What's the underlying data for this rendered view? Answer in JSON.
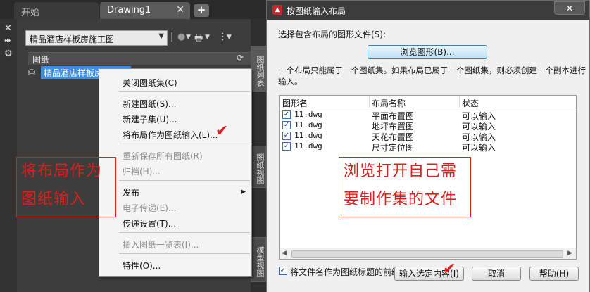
{
  "tabs": {
    "start": "开始",
    "drawing": "Drawing1",
    "close": "✕",
    "new_tab": "+"
  },
  "left_strip": {
    "close": "✕",
    "pin": "⇹",
    "props": "⚙"
  },
  "palette": {
    "sheet_set": "精品酒店样板房施工图",
    "tree_header": "图纸",
    "tree_item": "精品酒店样板房施工图",
    "vertical_tabs": [
      "图纸列表",
      "图纸视图",
      "模型视图"
    ]
  },
  "context_menu": {
    "items": [
      {
        "label": "关闭图纸集(C)",
        "disabled": false
      },
      {
        "label": "新建图纸(S)...",
        "disabled": false
      },
      {
        "label": "新建子集(U)...",
        "disabled": false
      },
      {
        "label": "将布局作为图纸输入(L)...",
        "disabled": false
      },
      {
        "label": "重新保存所有图纸(R)",
        "disabled": true
      },
      {
        "label": "归档(H)...",
        "disabled": true
      },
      {
        "label": "发布",
        "disabled": false
      },
      {
        "label": "电子传递(E)...",
        "disabled": true
      },
      {
        "label": "传递设置(T)...",
        "disabled": false
      },
      {
        "label": "插入图纸一览表(I)...",
        "disabled": true
      },
      {
        "label": "特性(O)...",
        "disabled": false
      }
    ]
  },
  "annotations": {
    "left": [
      "将布局作为",
      "图纸输入"
    ],
    "right": [
      "浏览打开自己需",
      "要制作集的文件"
    ],
    "check": "✔"
  },
  "dialog": {
    "title": "按图纸输入布局",
    "close": "✕",
    "select_label": "选择包含布局的图形文件(S):",
    "browse_button": "浏览图形(B)...",
    "info_line1": "一个布局只能属于一个图纸集。如果布局已属于一个图纸集，则必须创建一个副本进行",
    "info_line2": "输入。",
    "columns": [
      "图形名",
      "布局名称",
      "状态"
    ],
    "rows": [
      {
        "file": "11.dwg",
        "layout": "平面布置图",
        "status": "可以输入",
        "checked": true
      },
      {
        "file": "11.dwg",
        "layout": "地坪布置图",
        "status": "可以输入",
        "checked": true
      },
      {
        "file": "11.dwg",
        "layout": "天花布置图",
        "status": "可以输入",
        "checked": true
      },
      {
        "file": "11.dwg",
        "layout": "尺寸定位图",
        "status": "可以输入",
        "checked": true
      }
    ],
    "prefix_option": "将文件名作为图纸标题的前缀(P)",
    "prefix_checked": true,
    "import_button": "输入选定内容(I)",
    "cancel_button": "取消",
    "help_button": "帮助(H)"
  },
  "colors": {
    "accent": "#e21b1b",
    "selection": "#3a8ee6",
    "title_bar": "#3c3c3c"
  }
}
